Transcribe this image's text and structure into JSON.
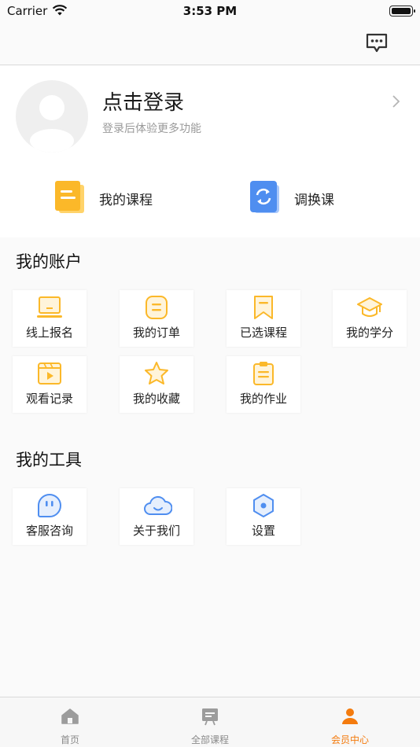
{
  "status_bar": {
    "carrier": "Carrier",
    "time": "3:53 PM"
  },
  "profile": {
    "login_title": "点击登录",
    "login_subtitle": "登录后体验更多功能",
    "quick_links": [
      {
        "label": "我的课程",
        "icon": "course-book-icon"
      },
      {
        "label": "调换课",
        "icon": "swap-refresh-icon"
      }
    ]
  },
  "account_section": {
    "title": "我的账户",
    "items": [
      {
        "label": "线上报名",
        "icon": "laptop-icon"
      },
      {
        "label": "我的订单",
        "icon": "order-icon"
      },
      {
        "label": "已选课程",
        "icon": "bookmark-icon"
      },
      {
        "label": "我的学分",
        "icon": "graduation-cap-icon"
      },
      {
        "label": "观看记录",
        "icon": "video-play-icon"
      },
      {
        "label": "我的收藏",
        "icon": "star-icon"
      },
      {
        "label": "我的作业",
        "icon": "clipboard-icon"
      }
    ]
  },
  "tools_section": {
    "title": "我的工具",
    "items": [
      {
        "label": "客服咨询",
        "icon": "chat-support-icon"
      },
      {
        "label": "关于我们",
        "icon": "cloud-smile-icon"
      },
      {
        "label": "设置",
        "icon": "settings-hexagon-icon"
      }
    ]
  },
  "tab_bar": {
    "active": "会员中心",
    "tabs": [
      {
        "label": "首页",
        "icon": "home-icon"
      },
      {
        "label": "全部课程",
        "icon": "courses-icon"
      },
      {
        "label": "会员中心",
        "icon": "person-icon"
      }
    ]
  },
  "colors": {
    "accent_orange": "#f47b0e",
    "icon_yellow": "#fbb829",
    "icon_blue": "#4f8ef0",
    "page_bg": "#fafafa"
  }
}
